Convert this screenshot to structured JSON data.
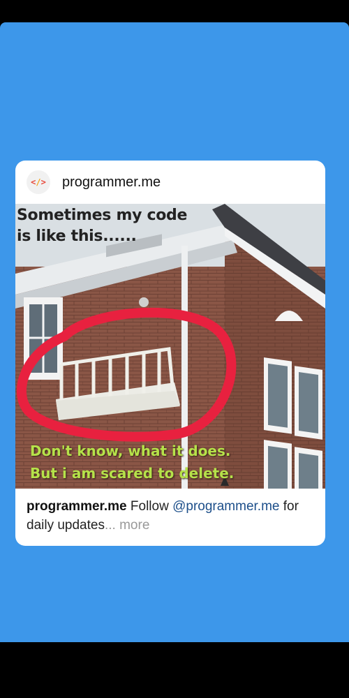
{
  "post": {
    "account_name": "programmer.me",
    "avatar_icon": "code-brackets-icon",
    "avatar_text": "</>",
    "meme": {
      "top_text_line1": "Sometimes my code",
      "top_text_line2": "is like this......",
      "bottom_text_line1": "Don't know, what it does.",
      "bottom_text_line2": "But i am scared to delete."
    },
    "caption": {
      "username": "programmer.me",
      "text_before_mention": " Follow ",
      "mention": "@programmer.me",
      "text_after_mention": " for daily updates",
      "ellipsis": "...",
      "more_label": " more"
    }
  },
  "colors": {
    "background_blue": "#3d97ea",
    "mention_blue": "#1d4f8a",
    "meme_text_green": "#b6e24a",
    "circle_red": "#e8213f"
  }
}
